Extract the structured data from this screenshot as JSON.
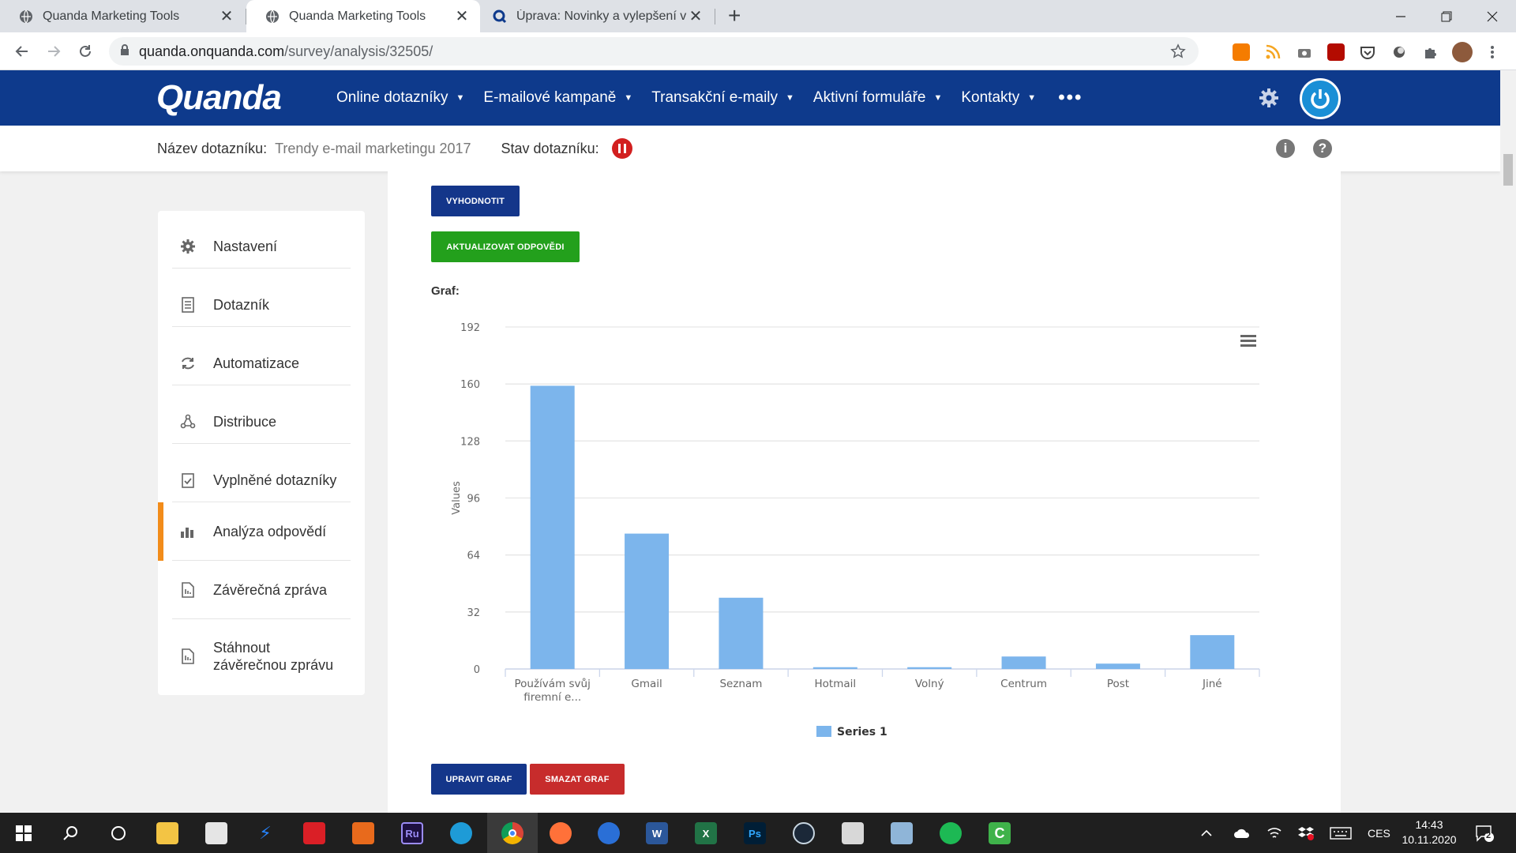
{
  "browser": {
    "tabs": [
      {
        "title": "Quanda Marketing Tools",
        "icon": "globe-icon"
      },
      {
        "title": "Quanda Marketing Tools",
        "icon": "globe-icon",
        "active": true
      },
      {
        "title": "Úprava: Novinky a vylepšení v Dc",
        "icon": "quanda-icon"
      }
    ],
    "url_host": "quanda.onquanda.com",
    "url_path": "/survey/analysis/32505/"
  },
  "app": {
    "logo": "Quanda",
    "menu": [
      {
        "label": "Online dotazníky"
      },
      {
        "label": "E-mailové kampaně"
      },
      {
        "label": "Transakční e-maily"
      },
      {
        "label": "Aktivní formuláře"
      },
      {
        "label": "Kontakty"
      }
    ],
    "more": "•••"
  },
  "subbar": {
    "name_label": "Název dotazníku:",
    "name_value": "Trendy e-mail marketingu 2017",
    "status_label": "Stav dotazníku:",
    "info_glyph": "i",
    "help_glyph": "?"
  },
  "sidebar": {
    "items": [
      {
        "label": "Nastavení",
        "icon": "gear-icon"
      },
      {
        "label": "Dotazník",
        "icon": "document-icon"
      },
      {
        "label": "Automatizace",
        "icon": "refresh-icon"
      },
      {
        "label": "Distribuce",
        "icon": "share-icon"
      },
      {
        "label": "Vyplněné dotazníky",
        "icon": "checklist-icon"
      },
      {
        "label": "Analýza odpovědí",
        "icon": "bar-chart-icon",
        "active": true
      },
      {
        "label": "Závěrečná zpráva",
        "icon": "report-icon"
      },
      {
        "label": "Stáhnout závěrečnou zprávu",
        "icon": "download-report-icon"
      }
    ]
  },
  "panel": {
    "evaluate_button": "VYHODNOTIT",
    "update_button": "AKTUALIZOVAT ODPOVĚDI",
    "graph_label": "Graf:",
    "edit_button": "UPRAVIT GRAF",
    "delete_button": "SMAZAT GRAF"
  },
  "chart_data": {
    "type": "bar",
    "categories": [
      "Používám svůj firemní e...",
      "Gmail",
      "Seznam",
      "Hotmail",
      "Volný",
      "Centrum",
      "Post",
      "Jiné"
    ],
    "category_lines": [
      [
        "Používám svůj",
        "firemní e..."
      ],
      [
        "Gmail"
      ],
      [
        "Seznam"
      ],
      [
        "Hotmail"
      ],
      [
        "Volný"
      ],
      [
        "Centrum"
      ],
      [
        "Post"
      ],
      [
        "Jiné"
      ]
    ],
    "series": [
      {
        "name": "Series 1",
        "values": [
          159,
          76,
          40,
          1,
          1,
          7,
          3,
          19
        ],
        "color": "#7cb5ec"
      }
    ],
    "ylabel": "Values",
    "ylim": [
      0,
      192
    ],
    "yticks": [
      0,
      32,
      64,
      96,
      128,
      160,
      192
    ],
    "grid": true,
    "legend": "bottom-center"
  },
  "taskbar": {
    "language": "CES",
    "time": "14:43",
    "date": "10.11.2020",
    "notifications": "2"
  }
}
